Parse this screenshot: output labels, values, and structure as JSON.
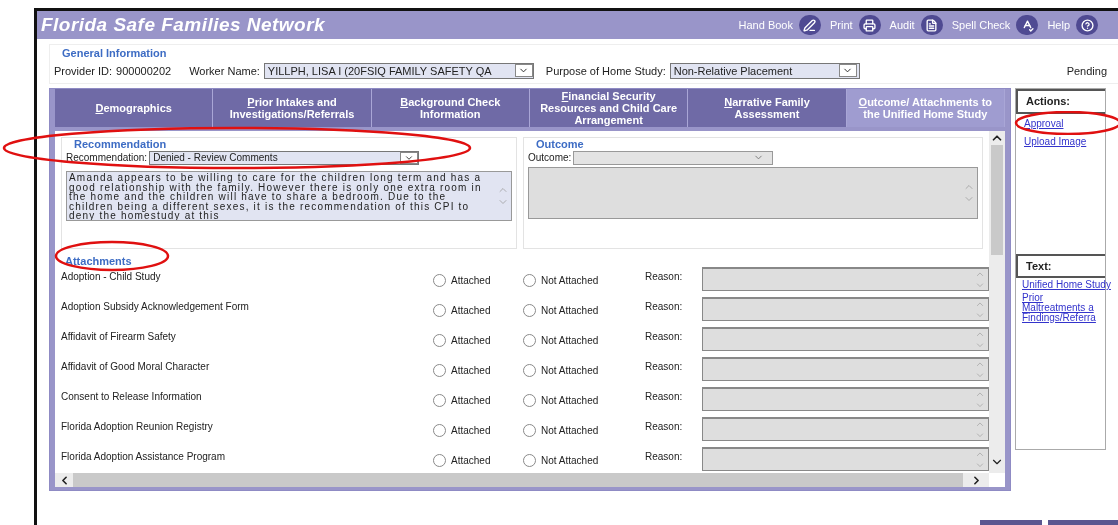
{
  "window": {
    "title": "Florida Safe Families Network"
  },
  "toolbar": [
    {
      "label": "Hand Book",
      "kind": "handbook"
    },
    {
      "label": "Print",
      "kind": "print"
    },
    {
      "label": "Audit",
      "kind": "audit"
    },
    {
      "label": "Spell Check",
      "kind": "spellcheck"
    },
    {
      "label": "Help",
      "kind": "help"
    }
  ],
  "general_information": {
    "title": "General Information",
    "provider_id_label": "Provider ID:",
    "provider_id": "900000202",
    "worker_name_label": "Worker Name:",
    "worker_name": "YILLPH, LISA I (20FSIQ FAMILY SAFETY QA",
    "purpose_label": "Purpose of Home Study:",
    "purpose": "Non-Relative Placement",
    "status": "Pending"
  },
  "tabs": [
    {
      "label": "Demographics",
      "selected": false
    },
    {
      "label": "Prior Intakes and Investigations/Referrals",
      "selected": false
    },
    {
      "label": "Background Check Information",
      "selected": false
    },
    {
      "label": "Financial Security Resources and Child Care Arrangement",
      "selected": false
    },
    {
      "label": "Narrative Family Assessment",
      "selected": false
    },
    {
      "label": "Outcome/ Attachments to the Unified Home Study",
      "selected": true
    }
  ],
  "recommendation": {
    "title": "Recommendation",
    "label": "Recommendation:",
    "value": "Denied - Review Comments",
    "comments": "Amanda appears to be willing to care for the children long term and has a good relationship with the family. However there is only one extra room in the home and the children will have to share a bedroom. Due to the children being a different sexes, it is the recommendation of this CPI to deny the homestudy at this"
  },
  "outcome": {
    "title": "Outcome",
    "label": "Outcome:"
  },
  "attachments": {
    "title": "Attachments",
    "rows": [
      {
        "name": "Adoption - Child Study",
        "attached_label": "Attached",
        "attached": false,
        "not_attached_label": "Not Attached",
        "not_attached": false,
        "reason_label": "Reason:"
      },
      {
        "name": "Adoption Subsidy Acknowledgement Form",
        "attached_label": "Attached",
        "attached": false,
        "not_attached_label": "Not Attached",
        "not_attached": false,
        "reason_label": "Reason:"
      },
      {
        "name": "Affidavit of Firearm Safety",
        "attached_label": "Attached",
        "attached": false,
        "not_attached_label": "Not Attached",
        "not_attached": false,
        "reason_label": "Reason:"
      },
      {
        "name": "Affidavit of Good Moral Character",
        "attached_label": "Attached",
        "attached": false,
        "not_attached_label": "Not Attached",
        "not_attached": false,
        "reason_label": "Reason:"
      },
      {
        "name": "Consent to Release Information",
        "attached_label": "Attached",
        "attached": false,
        "not_attached_label": "Not Attached",
        "not_attached": false,
        "reason_label": "Reason:"
      },
      {
        "name": "Florida Adoption Reunion Registry",
        "attached_label": "Attached",
        "attached": false,
        "not_attached_label": "Not Attached",
        "not_attached": false,
        "reason_label": "Reason:"
      },
      {
        "name": "Florida Adoption Assistance Program",
        "attached_label": "Attached",
        "attached": false,
        "not_attached_label": "Not Attached",
        "not_attached": false,
        "reason_label": "Reason:"
      }
    ]
  },
  "actions": {
    "title": "Actions:",
    "links": [
      "Approval",
      "Upload Image"
    ]
  },
  "text_panel": {
    "title": "Text:",
    "links": [
      {
        "lines": [
          "Unified Home Study"
        ]
      },
      {
        "lines": [
          "Prior",
          "Maltreatments a",
          "Findings/Referra"
        ]
      }
    ]
  }
}
